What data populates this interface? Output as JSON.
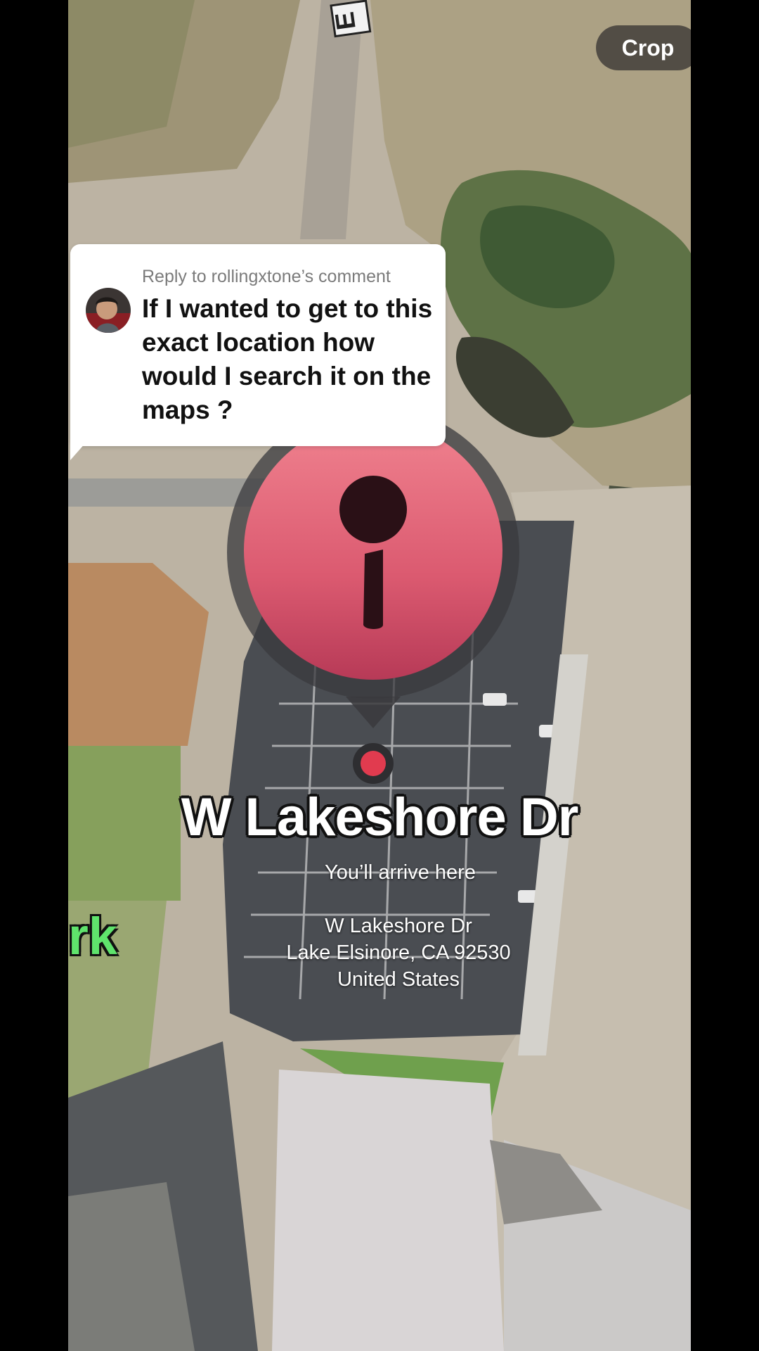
{
  "toolbar": {
    "crop_label": "Crop"
  },
  "comment": {
    "reply_to": "Reply to rollingxtone’s comment",
    "text": "If I wanted to get to this exact location how would I search it on the maps ?"
  },
  "map": {
    "street_label": "W Lakeshore Dr",
    "arrival_note": "You’ll arrive here",
    "address_line1": "W Lakeshore Dr",
    "address_line2": "Lake Elsinore, CA  92530",
    "address_line3": "United States",
    "partial_label": "rk",
    "road_marker": "E"
  },
  "colors": {
    "pin": "#e0566f",
    "pin_dark": "#2a1016",
    "park_label": "#5fe36c"
  }
}
